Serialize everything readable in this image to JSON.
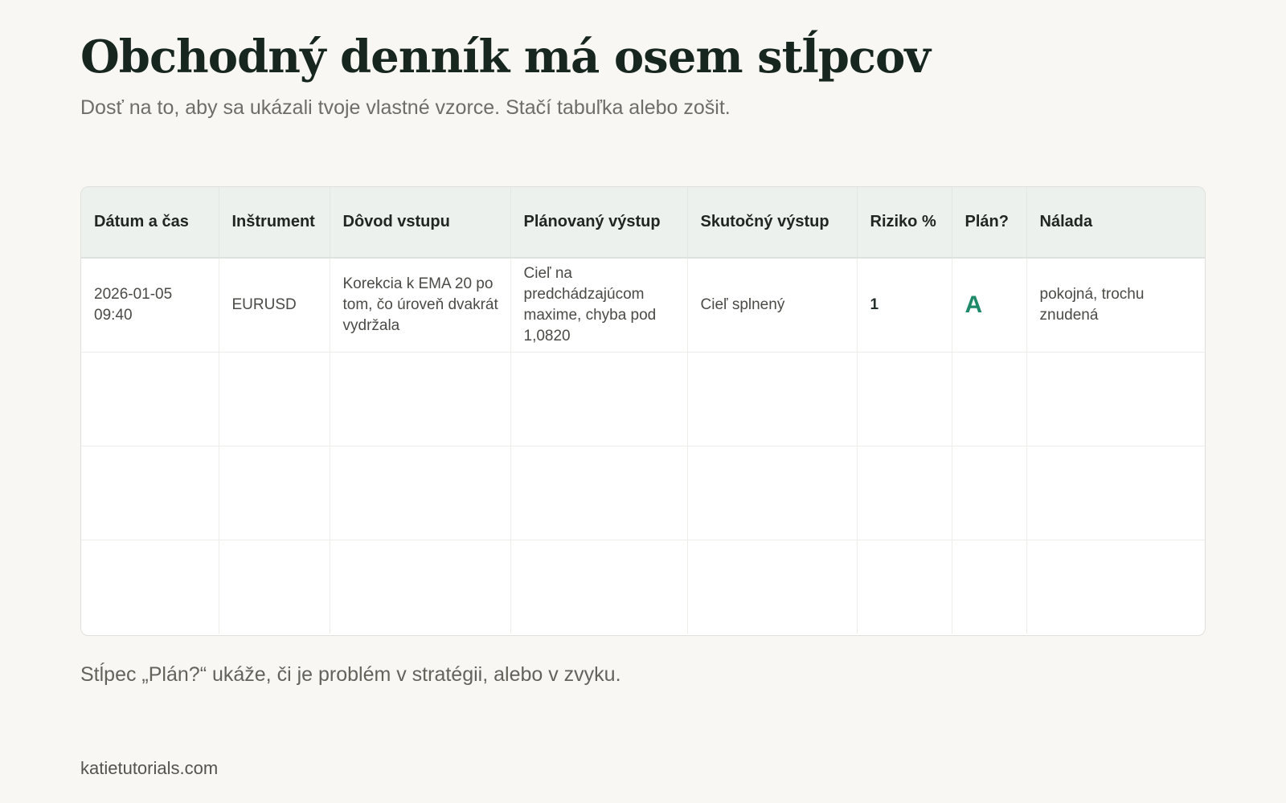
{
  "title": "Obchodný denník má osem stĺpcov",
  "subtitle": "Dosť na to, aby sa ukázali tvoje vlastné vzorce. Stačí tabuľka alebo zošit.",
  "table": {
    "headers": [
      "Dátum a čas",
      "Inštrument",
      "Dôvod vstupu",
      "Plánovaný výstup",
      "Skutočný výstup",
      "Riziko %",
      "Plán?",
      "Nálada"
    ],
    "rows": [
      [
        "2026-01-05 09:40",
        "EURUSD",
        "Korekcia k EMA 20 po tom, čo úroveň dvakrát vydržala",
        "Cieľ na predchádzajúcom maxime, chyba pod 1,0820",
        "Cieľ splnený",
        "1",
        "A",
        "pokojná, trochu znudená"
      ],
      [
        "",
        "",
        "",
        "",
        "",
        "",
        "",
        ""
      ],
      [
        "",
        "",
        "",
        "",
        "",
        "",
        "",
        ""
      ],
      [
        "",
        "",
        "",
        "",
        "",
        "",
        "",
        ""
      ]
    ]
  },
  "caption": "Stĺpec „Plán?“ ukáže, či je problém v stratégii, alebo v zvyku.",
  "footer": "katietutorials.com",
  "colors": {
    "background": "#f8f7f4",
    "header_background": "#ecf1ee",
    "plan_accent": "#1f8a6a",
    "title": "#17261f"
  }
}
